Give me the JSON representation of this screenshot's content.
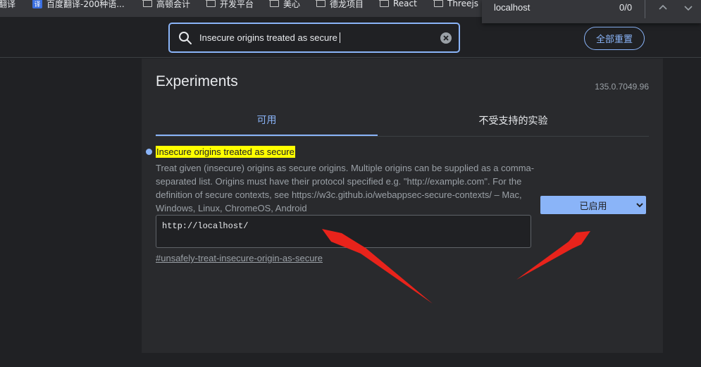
{
  "bookmarks": [
    {
      "label": "翻译",
      "icon": "translate-icon"
    },
    {
      "label": "百度翻译-200种语...",
      "icon": "baidu-translate-icon",
      "badge": "译"
    },
    {
      "label": "高顿会计",
      "icon": "folder-icon"
    },
    {
      "label": "开发平台",
      "icon": "folder-icon"
    },
    {
      "label": "美心",
      "icon": "folder-icon"
    },
    {
      "label": "德龙项目",
      "icon": "folder-icon"
    },
    {
      "label": "React",
      "icon": "folder-icon"
    },
    {
      "label": "Threejs",
      "icon": "folder-icon"
    }
  ],
  "find_bar": {
    "query": "localhost",
    "count": "0/0"
  },
  "search": {
    "value": "Insecure origins treated as secure"
  },
  "reset_all_label": "全部重置",
  "page": {
    "title": "Experiments",
    "version": "135.0.7049.96"
  },
  "tabs": [
    {
      "label": "可用",
      "active": true
    },
    {
      "label": "不受支持的实验",
      "active": false
    }
  ],
  "experiment": {
    "name": "Insecure origins treated as secure",
    "description": "Treat given (insecure) origins as secure origins. Multiple origins can be supplied as a comma-separated list. Origins must have their protocol specified e.g. \"http://example.com\". For the definition of secure contexts, see https://w3c.github.io/webappsec-secure-contexts/ – Mac, Windows, Linux, ChromeOS, Android",
    "origins_value": "http://localhost/",
    "permalink": "#unsafely-treat-insecure-origin-as-secure",
    "state": "已启用"
  },
  "colors": {
    "accent": "#8ab4f8",
    "highlight": "#ffff00",
    "arrow": "#e8231b",
    "background": "#202124",
    "panel": "#292a2d"
  }
}
